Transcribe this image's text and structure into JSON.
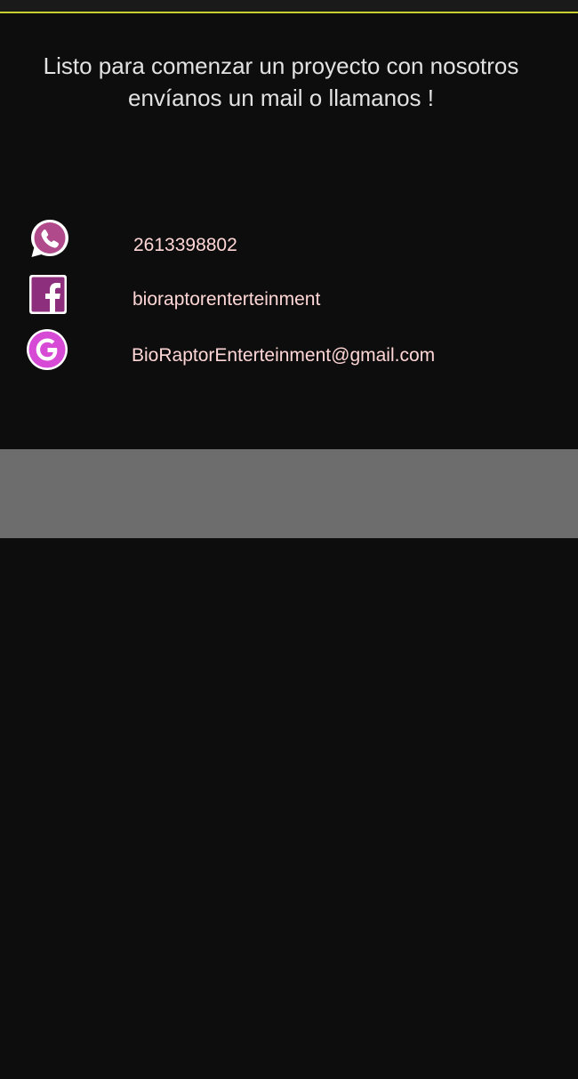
{
  "intro": {
    "line1": "Listo para comenzar un proyecto con nosotros",
    "line2": "envíanos un mail o  llamanos !"
  },
  "contacts": [
    {
      "icon": "whatsapp-icon",
      "text": "2613398802"
    },
    {
      "icon": "facebook-icon",
      "text": "bioraptorenterteinment"
    },
    {
      "icon": "google-icon",
      "text": "BioRaptorEnterteinment@gmail.com"
    }
  ],
  "colors": {
    "background": "#0d0d0d",
    "accent_line": "#c6d12f",
    "intro_text": "#e2e2e2",
    "contact_text": "#ffd6d6",
    "whatsapp": "#b04a8a",
    "facebook": "#8e2f7e",
    "google": "#d64ad6",
    "band": "#6d6d6d"
  }
}
